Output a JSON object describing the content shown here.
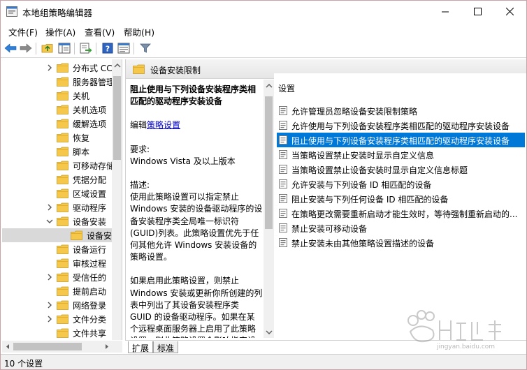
{
  "window": {
    "title": "本地组策略编辑器"
  },
  "menu": [
    "文件(F)",
    "操作(A)",
    "查看(V)",
    "帮助(H)"
  ],
  "toolbar": [
    "back-icon",
    "forward-icon",
    "up-folder-icon",
    "show-hide-tree-icon",
    "export-icon",
    "help-icon",
    "properties-icon",
    "filter-icon"
  ],
  "tree": {
    "items": [
      {
        "label": "分布式 CC",
        "expandable": true,
        "depth": 0
      },
      {
        "label": "服务器管理",
        "expandable": false,
        "depth": 0
      },
      {
        "label": "关机",
        "expandable": false,
        "depth": 0
      },
      {
        "label": "关机选项",
        "expandable": false,
        "depth": 0
      },
      {
        "label": "缓解选项",
        "expandable": false,
        "depth": 0
      },
      {
        "label": "恢复",
        "expandable": false,
        "depth": 0
      },
      {
        "label": "脚本",
        "expandable": false,
        "depth": 0
      },
      {
        "label": "可移动存储",
        "expandable": false,
        "depth": 0
      },
      {
        "label": "凭据分配",
        "expandable": false,
        "depth": 0
      },
      {
        "label": "区域设置",
        "expandable": false,
        "depth": 0
      },
      {
        "label": "驱动程序",
        "expandable": true,
        "depth": 0
      },
      {
        "label": "设备安装",
        "expandable": true,
        "expanded": true,
        "depth": 0
      },
      {
        "label": "设备安",
        "expandable": false,
        "depth": 1,
        "selected": true
      },
      {
        "label": "设备运行",
        "expandable": false,
        "depth": 0
      },
      {
        "label": "审核过程",
        "expandable": false,
        "depth": 0
      },
      {
        "label": "受信任的",
        "expandable": true,
        "depth": 0
      },
      {
        "label": "提前启动",
        "expandable": false,
        "depth": 0
      },
      {
        "label": "网络登录",
        "expandable": true,
        "depth": 0
      },
      {
        "label": "文件分类",
        "expandable": true,
        "depth": 0
      },
      {
        "label": "文件共享",
        "expandable": false,
        "depth": 0
      }
    ]
  },
  "right_pane": {
    "header": "设备安装限制",
    "description": {
      "title": "阻止使用与下列设备安装程序类相匹配的驱动程序安装设备",
      "edit_prefix": "编辑",
      "edit_link": "策略设置",
      "requirements_label": "要求:",
      "requirements_value": "Windows Vista 及以上版本",
      "description_label": "描述:",
      "description_text": "使用此策略设置可以指定禁止 Windows 安装的设备驱动程序的设备安装程序类全局唯一标识符(GUID)列表。此策略设置优先于任何其他允许 Windows 安装设备的策略设置。",
      "description_text2": "如果启用此策略设置，则禁止 Windows 安装或更新你所创建的列表中列出了其设备安装程序类 GUID 的设备驱动程序。如果在某个远程桌面服务器上启用了此策略设置，则此策略设置会影响指定设"
    },
    "list_header": "设置",
    "settings": [
      "允许管理员忽略设备安装限制策略",
      "允许使用与下列设备安装程序类相匹配的驱动程序安装设备",
      "阻止使用与下列设备安装程序类相匹配的驱动程序安装设备",
      "当策略设置禁止安装时显示自定义信息",
      "当策略设置禁止设备安装时显示自定义信息标题",
      "允许安装与下列设备 ID 相匹配的设备",
      "阻止安装与下列任何设备 ID 相匹配的设备",
      "在策略更改需要重新启动才能生效时，等待强制重新启动的...",
      "禁止安装可移动设备",
      "禁止安装未由其他策略设置描述的设备"
    ],
    "selected_index": 2
  },
  "tabs": [
    "扩展",
    "标准"
  ],
  "status": "10 个设置",
  "colors": {
    "selection": "#0078d7",
    "folder": "#f5c84c",
    "link": "#0000cc"
  }
}
